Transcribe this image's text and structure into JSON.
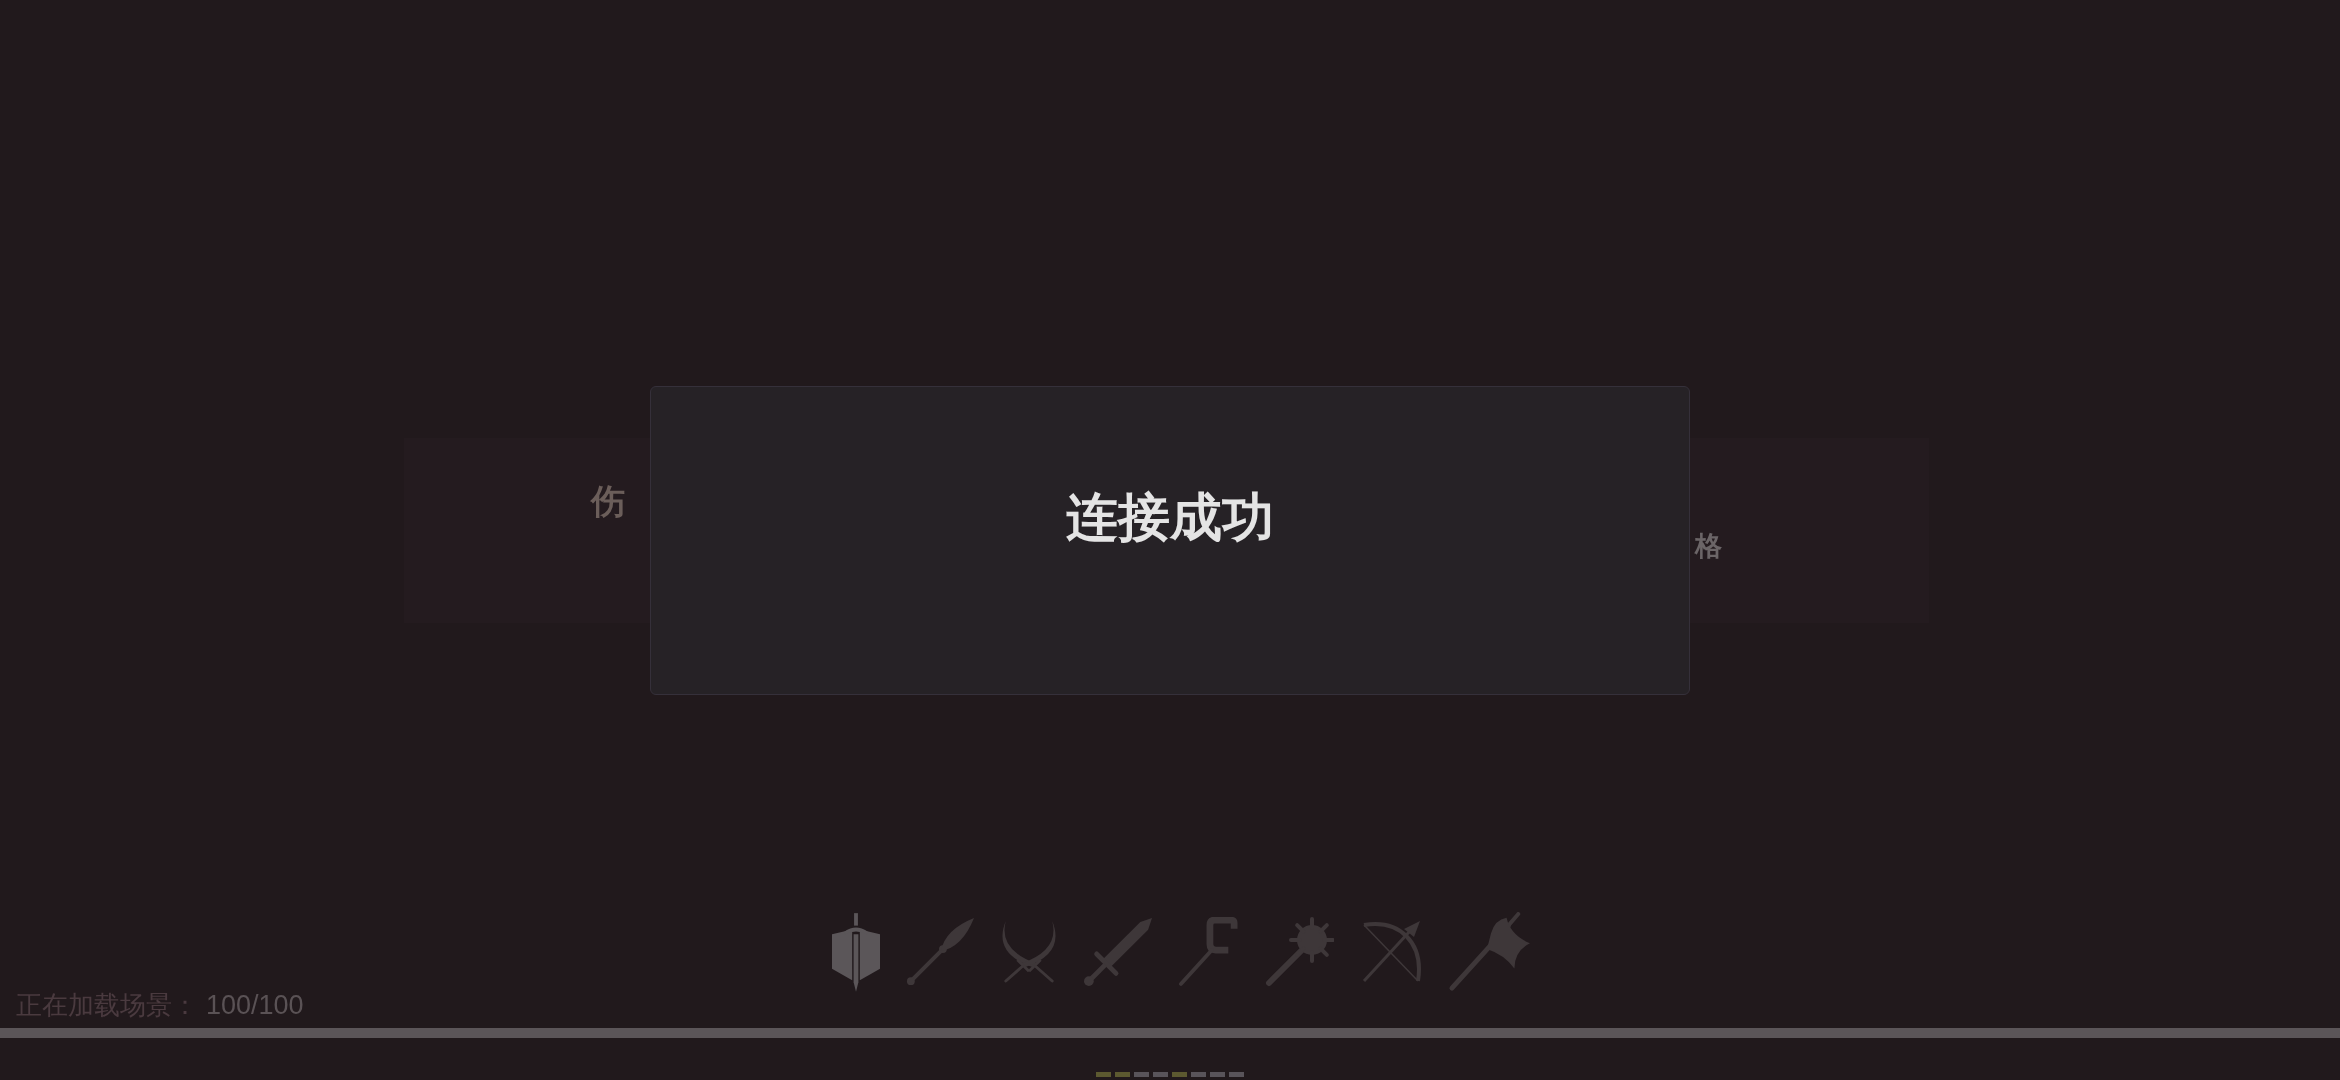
{
  "left_card": {
    "text": "伤"
  },
  "right_card": {
    "text": "格"
  },
  "dialog": {
    "title": "连接成功"
  },
  "weapons": [
    {
      "selected": true
    },
    {
      "selected": false
    },
    {
      "selected": false
    },
    {
      "selected": false
    },
    {
      "selected": false
    },
    {
      "selected": false
    },
    {
      "selected": false
    },
    {
      "selected": false
    }
  ],
  "loading": {
    "label": "正在加载场景：",
    "value": "100/100",
    "level": 1
  },
  "page_dots": [
    {
      "color": "#5c5930"
    },
    {
      "color": "#5c5930"
    },
    {
      "color": "#59545a"
    },
    {
      "color": "#59545a"
    },
    {
      "color": "#5c5930"
    },
    {
      "color": "#59545a"
    },
    {
      "color": "#59545a"
    },
    {
      "color": "#59545a"
    }
  ]
}
